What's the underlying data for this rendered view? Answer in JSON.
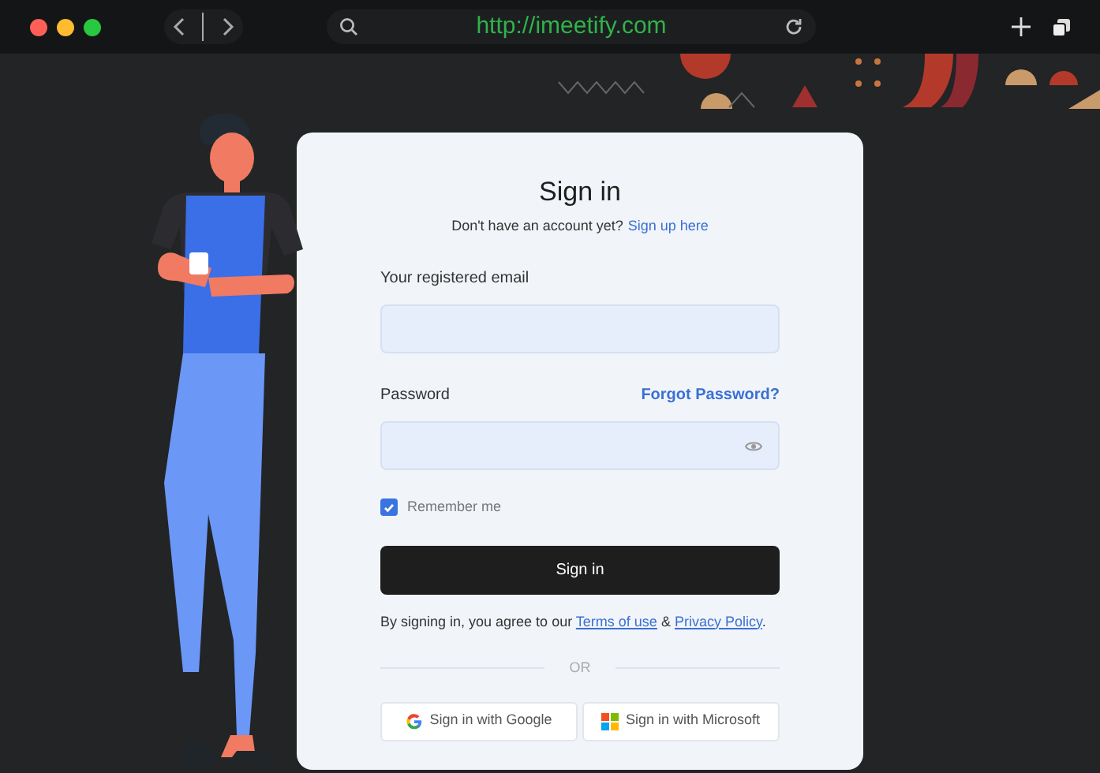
{
  "browser": {
    "url": "http://imeetify.com"
  },
  "card": {
    "title": "Sign in",
    "prompt": "Don't have an account yet?",
    "signup_link": "Sign up here",
    "fields": [
      {
        "label": "Your registered email",
        "kind": "email"
      },
      {
        "label": "Password",
        "kind": "password",
        "link": "Forgot Password?"
      }
    ],
    "remember": {
      "label": "Remember me",
      "checked": true
    },
    "submit": "Sign in",
    "terms": {
      "before": "By signing in, you agree to our",
      "terms_link": "Terms of use",
      "joiner": "&",
      "privacy_link": "Privacy Policy",
      "after": "."
    },
    "divider": "OR",
    "social": [
      {
        "kind": "google",
        "label": "Sign in with Google"
      },
      {
        "kind": "microsoft",
        "label": "Sign in with Microsoft"
      }
    ]
  }
}
